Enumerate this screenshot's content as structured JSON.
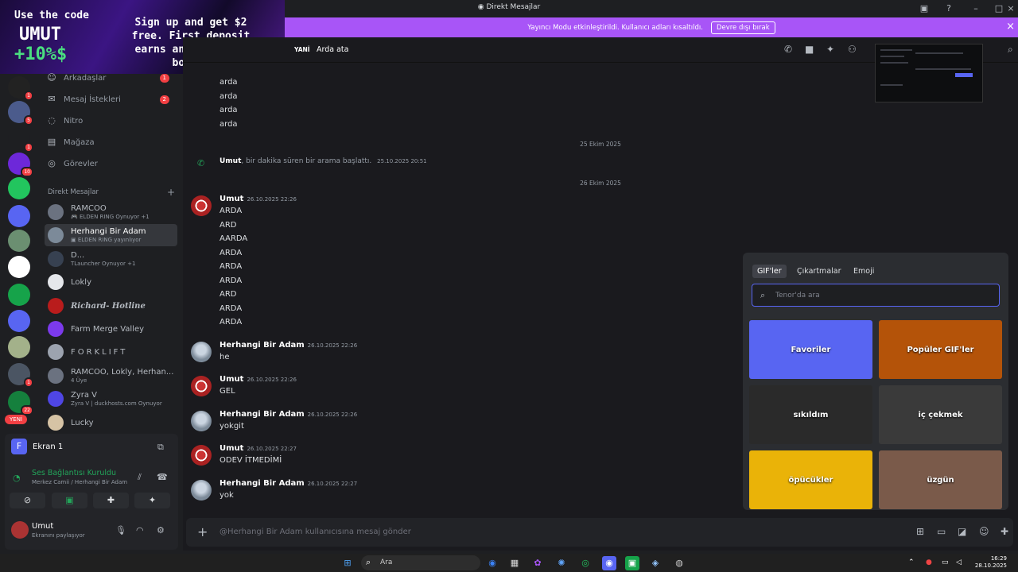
{
  "window": {
    "title": "Direkt Mesajlar"
  },
  "ad": {
    "line1": "Use the code",
    "code": "UMUT",
    "bonus": "+10%$",
    "right": "Sign up and get $2 free. First deposit earns an extra 20% bonus."
  },
  "banner": {
    "text": "Yayıncı Modu etkinleştirildi. Kullanıcı adları kısaltıldı.",
    "button": "Devre dışı bırak",
    "color": "#a855f7"
  },
  "servers": [
    {
      "badge": "1",
      "color": "#222"
    },
    {
      "badge": "5",
      "color": "#4b5b8c"
    },
    {
      "badge": "1",
      "color": "#1e1f22"
    },
    {
      "badge": "10",
      "color": "#6d28d9"
    },
    {
      "badge": "",
      "color": "#22c55e"
    },
    {
      "badge": "",
      "color": "#5865f2"
    },
    {
      "badge": "",
      "color": "#6b8f71"
    },
    {
      "badge": "",
      "color": "#ffffff"
    },
    {
      "badge": "",
      "color": "#16a34a"
    },
    {
      "badge": "",
      "color": "#5865f2"
    },
    {
      "badge": "",
      "color": "#a3b18a"
    },
    {
      "badge": "1",
      "color": "#4b5563"
    },
    {
      "badge": "22",
      "color": "#15803d"
    }
  ],
  "nav": [
    {
      "label": "Arkadaşlar",
      "icon": "friends-icon",
      "badge": "1"
    },
    {
      "label": "Mesaj İstekleri",
      "icon": "mail-icon",
      "badge": "2"
    },
    {
      "label": "Nitro",
      "icon": "nitro-icon",
      "badge": ""
    },
    {
      "label": "Mağaza",
      "icon": "shop-icon",
      "badge": ""
    },
    {
      "label": "Görevler",
      "icon": "quests-icon",
      "badge": ""
    }
  ],
  "dm_header": "Direkt Mesajlar",
  "dms": [
    {
      "name": "RAMCOO",
      "status": "🎮 ELDEN RING Oynuyor +1",
      "color": "#6b7280"
    },
    {
      "name": "Herhangi Bir Adam",
      "status": "▣ ELDEN RING yayınlıyor",
      "color": "#7c8a99"
    },
    {
      "name": "D...",
      "status": "TLauncher Oynuyor +1",
      "color": "#374151"
    },
    {
      "name": "Lokly",
      "status": "",
      "color": "#e5e7eb"
    },
    {
      "name": "Richard- Hotline",
      "status": "",
      "color": "#b91c1c"
    },
    {
      "name": "Farm Merge Valley",
      "status": "",
      "color": "#7c3aed"
    },
    {
      "name": "FORKLIFT",
      "status": "",
      "color": "#9ca3af"
    },
    {
      "name": "RAMCOO, Lokly, Herhan...",
      "status": "4 Üye",
      "color": "#6b7280"
    },
    {
      "name": "Zyra V",
      "status": "Zyra V | duckhosts.com Oynuyor",
      "color": "#4f46e5"
    },
    {
      "name": "Lucky",
      "status": "",
      "color": "#d6c3a5"
    }
  ],
  "yeni": "YENİ",
  "voice": {
    "screen_title": "Ekran 1",
    "status": "Ses Bağlantısı Kuruldu",
    "sub": "Merkez Camii / Herhangi Bir Adam"
  },
  "user": {
    "name": "Umut",
    "status": "Ekranını paylaşıyor"
  },
  "chat": {
    "new_label": "YANİ",
    "name": "Arda ata",
    "top_lines": [
      "arda",
      "arda",
      "arda",
      "arda"
    ],
    "sep1": "25 Ekim 2025",
    "call": {
      "name": "Umut",
      "text": ", bir dakika süren bir arama başlattı.",
      "time": "25.10.2025 20:51"
    },
    "sep2": "26 Ekim 2025",
    "umut_block": {
      "name": "Umut",
      "time": "26.10.2025 22:26",
      "lines": [
        "ARDA",
        "ARD",
        "AARDA",
        "ARDA",
        "ARDA",
        "ARDA",
        "ARD",
        "ARDA",
        "ARDA"
      ]
    },
    "messages": [
      {
        "name": "Herhangi Bir Adam",
        "time": "26.10.2025 22:26",
        "text": "he",
        "who": "h"
      },
      {
        "name": "Umut",
        "time": "26.10.2025 22:26",
        "text": "GEL",
        "who": "u"
      },
      {
        "name": "Herhangi Bir Adam",
        "time": "26.10.2025 22:26",
        "text": "yokgit",
        "who": "h"
      },
      {
        "name": "Umut",
        "time": "26.10.2025 22:27",
        "text": "ODEV İTMEDİMİ",
        "who": "u"
      },
      {
        "name": "Herhangi Bir Adam",
        "time": "26.10.2025 22:27",
        "text": "yok",
        "who": "h"
      }
    ],
    "composer_placeholder": "@Herhangi Bir Adam kullanıcısına mesaj gönder"
  },
  "gif": {
    "tabs": [
      "GIF'ler",
      "Çıkartmalar",
      "Emoji"
    ],
    "search_placeholder": "Tenor'da ara",
    "tiles": [
      {
        "label": "Favoriler",
        "bg": "#5865f2"
      },
      {
        "label": "Popüler GIF'ler",
        "bg": "#b45309"
      },
      {
        "label": "sıkıldım",
        "bg": "#2a2a2a"
      },
      {
        "label": "iç çekmek",
        "bg": "#3a3a3a"
      },
      {
        "label": "öpücükler",
        "bg": "#eab308"
      },
      {
        "label": "üzgün",
        "bg": "#7a5a4a"
      }
    ]
  },
  "taskbar": {
    "search": "Ara",
    "time": "16:29",
    "date": "28.10.2025"
  }
}
